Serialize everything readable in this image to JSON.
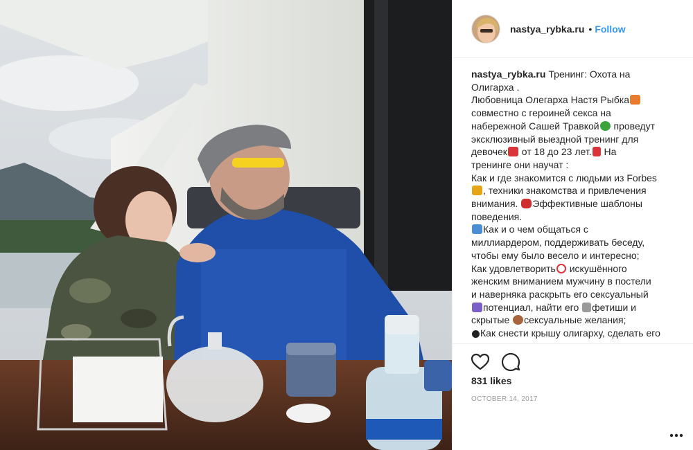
{
  "post": {
    "username": "nastya_rybka.ru",
    "separator": "•",
    "follow_label": "Follow",
    "caption_user": "nastya_rybka.ru",
    "caption_lines": [
      "Тренинг: Охота на",
      "Олигарха .",
      "Любовница Олегарха Настя Рыбка",
      "совместно с героиней секса на",
      "набережной Сашей Травкой",
      " проведут",
      "эксклюзивный выездной тренинг для",
      "девочек",
      " от 18 до 23 лет.",
      " На",
      "тренинге они научат :",
      "Как и где знакомится с людьми из Forbes",
      ", техники знакомства и привлечения",
      "внимания.",
      "Эффективные шаблоны",
      "поведения.",
      "Как и о чем общаться с",
      "миллиардером, поддерживать беседу,",
      "чтобы ему было весело и интересно;",
      "Как удовлетворить",
      " искушённого",
      "женским вниманием мужчину в постели",
      "и наверняка раскрыть его сексуальный",
      "потенциал, найти его ",
      "фетиши и",
      "скрытые ",
      "сексуальные желания;",
      "Как снести крышу олигарху, сделать его"
    ],
    "likes": "831 likes",
    "date": "OCTOBER 14, 2017"
  },
  "icons": {
    "like": "heart-icon",
    "comment": "comment-icon",
    "more": "more-options-icon"
  },
  "colors": {
    "link_blue": "#3897f0",
    "text": "#262626",
    "muted": "#999999",
    "border": "#efefef"
  }
}
